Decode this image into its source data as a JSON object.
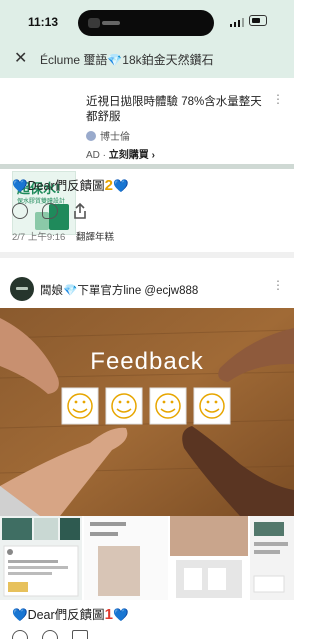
{
  "status": {
    "time": "11:13"
  },
  "nav": {
    "title": "Éclume 璽語💎18k鉑金天然鑽石",
    "close_glyph": "✕"
  },
  "ad": {
    "thumb_big": "超保水!",
    "thumb_sub": "保水膠質雙膜設計",
    "headline": "近視日拋限時體驗 78%含水量整天都舒服",
    "brand": "博士倫",
    "ad_label": "AD",
    "cta": "立刻購買",
    "cta_arrow": "›",
    "more_glyph": "⋮"
  },
  "post1": {
    "caption_prefix": "Dear們反饋圖",
    "caption_num": "2",
    "timestamp": "2/7 上午9:16",
    "translate": "翻譯年糕"
  },
  "post2": {
    "author": "闆娘💎下單官方line @ecjw888",
    "more_glyph": "⋮",
    "photo_word": "Feedback",
    "caption_prefix": "Dear們反饋圖",
    "caption_num": "1"
  },
  "colors": {
    "header_bg": "#dfeee7",
    "heart": "#5aa9e6",
    "num2": "#e8a400",
    "num1": "#e03a2f"
  }
}
